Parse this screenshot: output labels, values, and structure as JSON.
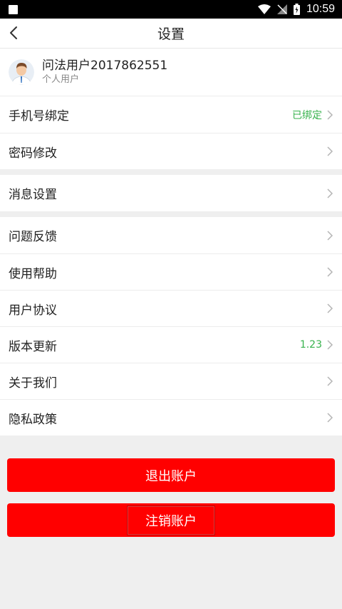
{
  "status": {
    "time": "10:59"
  },
  "header": {
    "title": "设置"
  },
  "profile": {
    "name": "问法用户2017862551",
    "type": "个人用户"
  },
  "group1": [
    {
      "label": "手机号绑定",
      "value": "已绑定"
    },
    {
      "label": "密码修改"
    }
  ],
  "group2": [
    {
      "label": "消息设置"
    }
  ],
  "group3": [
    {
      "label": "问题反馈"
    },
    {
      "label": "使用帮助"
    },
    {
      "label": "用户协议"
    },
    {
      "label": "版本更新",
      "value": "1.23"
    },
    {
      "label": "关于我们"
    },
    {
      "label": "隐私政策"
    }
  ],
  "buttons": {
    "logout": "退出账户",
    "deactivate": "注销账户"
  },
  "colors": {
    "accent": "#ff0000",
    "value_green": "#37b24d"
  }
}
